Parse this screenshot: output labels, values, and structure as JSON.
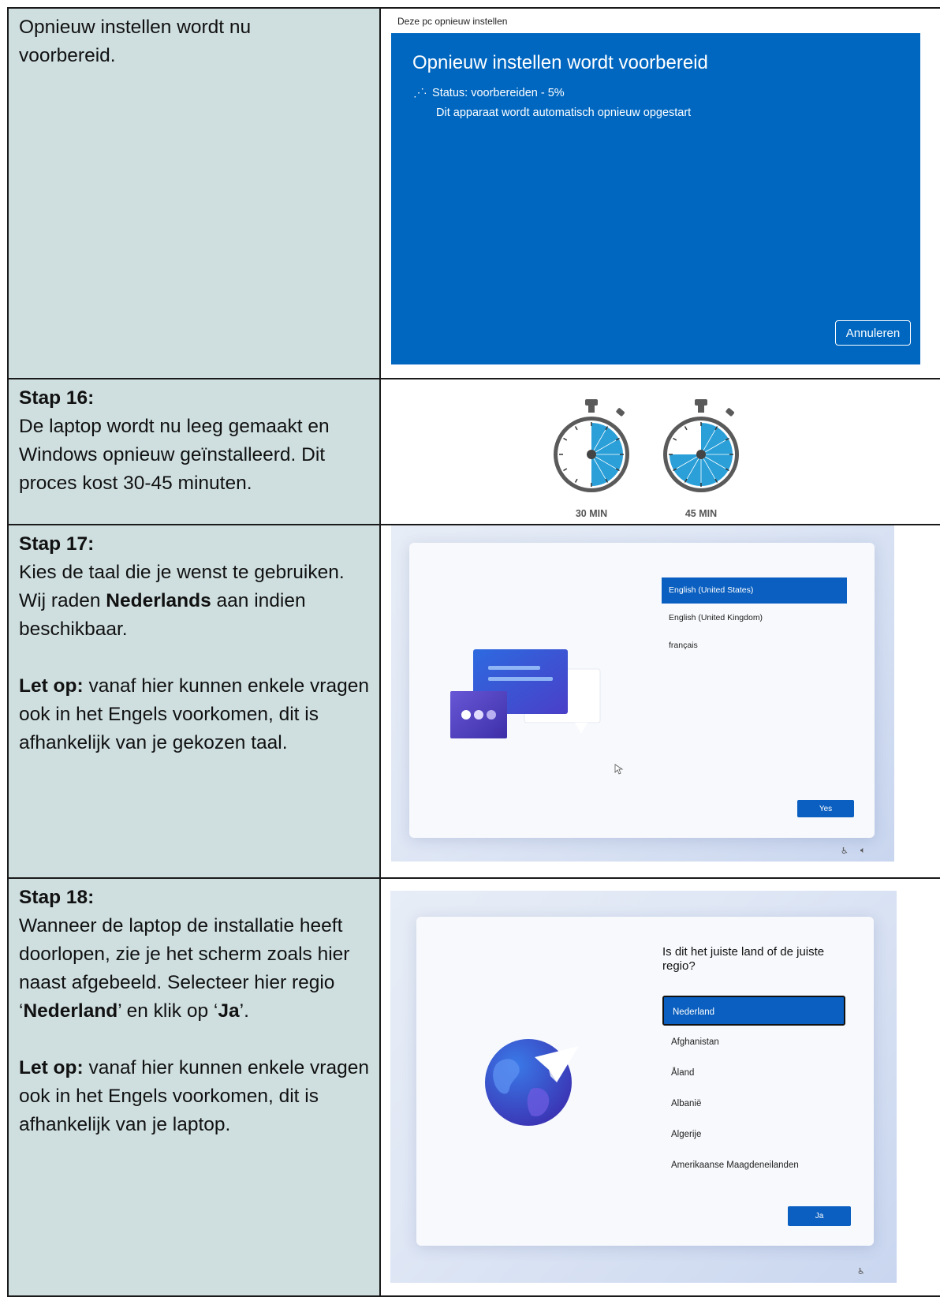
{
  "rows": [
    {
      "text_lines": [
        "Opnieuw instellen wordt nu",
        "voorbereid."
      ],
      "screenshot": {
        "window_title": "Deze pc opnieuw instellen",
        "heading": "Opnieuw instellen wordt voorbereid",
        "status": "Status: voorbereiden - 5%",
        "progress_percent": 5,
        "subtext": "Dit apparaat wordt automatisch opnieuw opgestart",
        "cancel_label": "Annuleren",
        "colors": {
          "accent": "#0067c0"
        }
      }
    },
    {
      "title": "Stap 16:",
      "body": "De laptop wordt nu leeg gemaakt en Windows opnieuw geïnstalleerd. Dit proces kost 30-45  minuten.",
      "stopwatches": [
        {
          "label": "30 MIN",
          "fraction": 0.5
        },
        {
          "label": "45 MIN",
          "fraction": 0.75
        }
      ],
      "colors": {
        "dial_fill": "#2a9fd8",
        "case": "#5a5a5a"
      }
    },
    {
      "title": "Stap 17:",
      "para1_pre": "Kies de taal die je wenst te gebruiken. Wij raden ",
      "para1_bold": "Nederlands",
      "para1_post": " aan indien beschikbaar.",
      "note_label": "Let op:",
      "note_text": " vanaf hier kunnen enkele vragen ook in het Engels voorkomen, dit is afhankelijk van je gekozen taal.",
      "screenshot": {
        "languages": [
          "English (United States)",
          "English (United Kingdom)",
          "français"
        ],
        "selected_index": 0,
        "button_label": "Yes"
      }
    },
    {
      "title": "Stap 18:",
      "para1_pre": "Wanneer de laptop de installatie heeft doorlopen, zie je het scherm zoals hier naast afgebeeld. Selecteer hier regio ‘",
      "para1_bold1": "Nederland",
      "para1_mid": "’ en klik op ‘",
      "para1_bold2": "Ja",
      "para1_post": "’.",
      "note_label": "Let op:",
      "note_text": " vanaf hier kunnen enkele vragen ook in het Engels voorkomen, dit is afhankelijk van je laptop.",
      "screenshot": {
        "question": "Is dit het juiste land of de juiste regio?",
        "countries": [
          "Nederland",
          "Afghanistan",
          "Åland",
          "Albanië",
          "Algerije",
          "Amerikaanse Maagdeneilanden"
        ],
        "selected_index": 0,
        "button_label": "Ja"
      }
    }
  ]
}
